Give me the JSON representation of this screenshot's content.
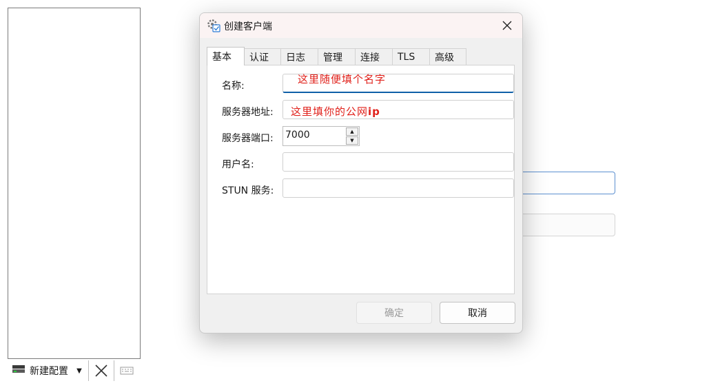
{
  "app": {
    "toolbar": {
      "new_config_label": "新建配置"
    }
  },
  "dialog": {
    "title": "创建客户端",
    "tabs": [
      "基本",
      "认证",
      "日志",
      "管理",
      "连接",
      "TLS",
      "高级"
    ],
    "active_tab": "基本",
    "fields": {
      "name_label": "名称:",
      "name_hint": "这里随便填个名字",
      "server_addr_label": "服务器地址:",
      "server_addr_hint_prefix": "这里填你的公网",
      "server_addr_hint_suffix": "ip",
      "server_port_label": "服务器端口:",
      "server_port_value": "7000",
      "username_label": "用户名:",
      "stun_label": "STUN 服务:"
    },
    "buttons": {
      "ok": "确定",
      "cancel": "取消"
    }
  },
  "colors": {
    "accent": "#0e5fa8",
    "hint": "#e0201a"
  }
}
